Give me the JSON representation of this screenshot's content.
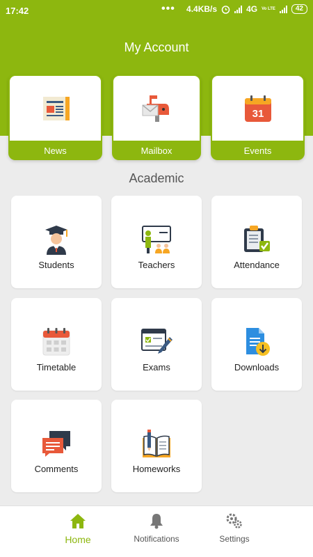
{
  "status": {
    "time": "17:42",
    "dots": "•••",
    "speed": "4.4KB/s",
    "network": "4G",
    "volte": "Vo LTE",
    "battery": "42"
  },
  "header": {
    "title": "My Account"
  },
  "top_cards": [
    {
      "label": "News",
      "icon": "newspaper-icon"
    },
    {
      "label": "Mailbox",
      "icon": "mailbox-icon"
    },
    {
      "label": "Events",
      "icon": "calendar-31-icon"
    }
  ],
  "calendar_day": "31",
  "section": {
    "title": "Academic"
  },
  "tiles": [
    {
      "label": "Students",
      "icon": "student-icon"
    },
    {
      "label": "Teachers",
      "icon": "teacher-icon"
    },
    {
      "label": "Attendance",
      "icon": "clipboard-check-icon"
    },
    {
      "label": "Timetable",
      "icon": "calendar-grid-icon"
    },
    {
      "label": "Exams",
      "icon": "exam-pencil-icon"
    },
    {
      "label": "Downloads",
      "icon": "download-file-icon"
    },
    {
      "label": "Comments",
      "icon": "chat-bubbles-icon"
    },
    {
      "label": "Homeworks",
      "icon": "open-book-pen-icon"
    }
  ],
  "bottom_nav": [
    {
      "label": "Home",
      "icon": "home-icon",
      "active": true
    },
    {
      "label": "Notifications",
      "icon": "bell-icon",
      "active": false
    },
    {
      "label": "Settings",
      "icon": "gears-icon",
      "active": false
    }
  ],
  "colors": {
    "primary": "#8db70f",
    "background": "#ececec",
    "card": "#ffffff"
  }
}
